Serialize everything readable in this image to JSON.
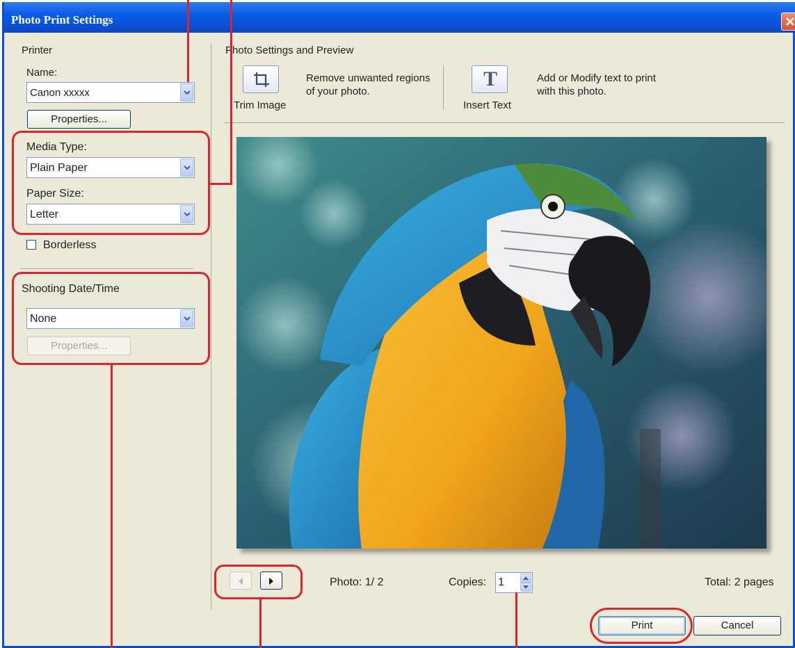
{
  "window": {
    "title": "Photo Print Settings"
  },
  "printer": {
    "group_label": "Printer",
    "name_label": "Name:",
    "name_value": "Canon xxxxx",
    "properties_label": "Properties...",
    "media_type_label": "Media Type:",
    "media_type_value": "Plain Paper",
    "paper_size_label": "Paper Size:",
    "paper_size_value": "Letter",
    "borderless_label": "Borderless",
    "borderless_checked": false
  },
  "shooting": {
    "label": "Shooting Date/Time",
    "value": "None",
    "properties_label": "Properties...",
    "properties_enabled": false
  },
  "preview": {
    "group_label": "Photo Settings and Preview",
    "trim": {
      "button_label": "Trim Image",
      "description": "Remove unwanted regions of your photo.",
      "icon": "crop-icon"
    },
    "insert_text": {
      "button_label": "Insert Text",
      "description": "Add or Modify text to print with this photo.",
      "icon_glyph": "T"
    }
  },
  "footer": {
    "photo_label": "Photo: 1/ 2",
    "copies_label": "Copies:",
    "copies_value": "1",
    "total_label": "Total: 2 pages",
    "print_label": "Print",
    "cancel_label": "Cancel"
  },
  "colors": {
    "callout": "#d7262d",
    "titlebar": "#0a5ee6",
    "dialog_bg": "#ece9d8"
  }
}
